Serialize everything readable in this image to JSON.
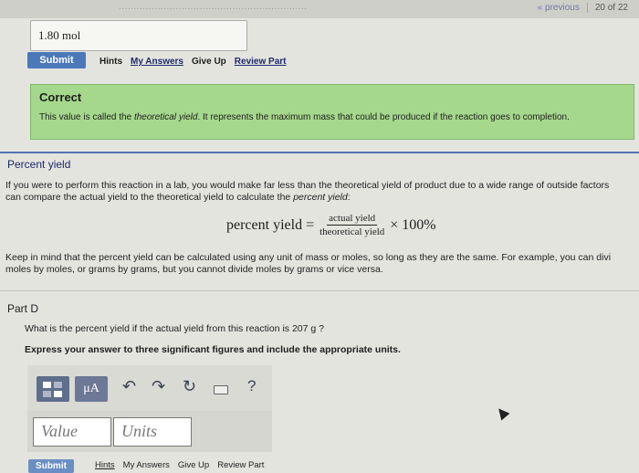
{
  "header": {
    "cut_title": "...............................................................",
    "previous_label": "« previous",
    "count": "20 of 22"
  },
  "part_c": {
    "answer_value": "1.80 mol",
    "submit_label": "Submit",
    "links": [
      "Hints",
      "My Answers",
      "Give Up",
      "Review Part"
    ],
    "feedback_title": "Correct",
    "feedback_text_1": "This value is called the ",
    "feedback_text_em": "theoretical yield",
    "feedback_text_2": ". It represents the maximum mass that could be produced if the reaction goes to completion."
  },
  "percent_yield": {
    "title": "Percent yield",
    "para1_line1": "If you were to perform this reaction in a lab, you would make far less than the theoretical yield of product due to a wide range of outside factors",
    "para1_line2_a": "can compare the actual yield to the theoretical yield to calculate the ",
    "para1_line2_em": "percent yield",
    "para1_line2_b": ":",
    "formula_lhs": "percent yield =",
    "formula_num": "actual yield",
    "formula_den": "theoretical yield",
    "formula_rhs": "× 100%",
    "para2_line1": "Keep in mind that the percent yield can be calculated using any unit of mass or moles, so long as they are the same. For example, you can divi",
    "para2_line2": "moles by moles, or grams by grams, but you cannot divide moles by grams or vice versa."
  },
  "part_d": {
    "title": "Part D",
    "question": "What is the percent yield if the actual yield from this reaction is 207 g ?",
    "instruction": "Express your answer to three significant figures and include the appropriate units.",
    "toolbar_mu": "μA",
    "toolbar_help": "?",
    "value_placeholder": "Value",
    "units_placeholder": "Units",
    "submit_label": "Submit",
    "links": [
      "Hints",
      "My Answers",
      "Give Up",
      "Review Part"
    ]
  }
}
